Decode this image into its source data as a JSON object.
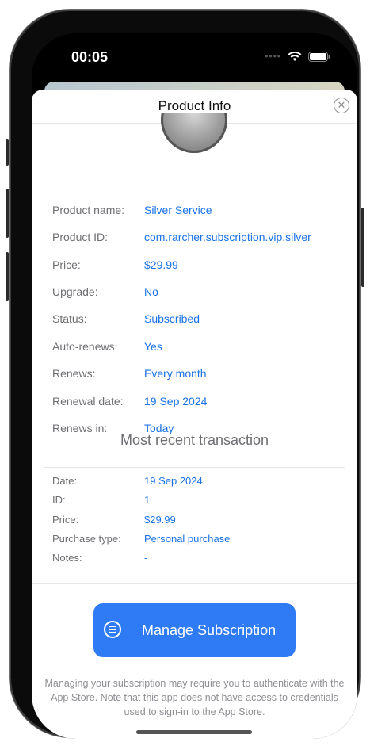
{
  "status_bar": {
    "time": "00:05"
  },
  "sheet": {
    "title": "Product Info",
    "close_icon": "xmark-circle",
    "badge_icon": "silver-laurel-badge"
  },
  "product": {
    "rows": [
      {
        "label": "Product name:",
        "value": "Silver Service"
      },
      {
        "label": "Product ID:",
        "value": "com.rarcher.subscription.vip.silver"
      },
      {
        "label": "Price:",
        "value": "$29.99"
      },
      {
        "label": "Upgrade:",
        "value": "No"
      },
      {
        "label": "Status:",
        "value": "Subscribed"
      },
      {
        "label": "Auto-renews:",
        "value": "Yes"
      },
      {
        "label": "Renews:",
        "value": "Every month"
      },
      {
        "label": "Renewal date:",
        "value": "19 Sep 2024"
      },
      {
        "label": "Renews in:",
        "value": "Today"
      }
    ]
  },
  "transaction": {
    "section_title": "Most recent transaction",
    "rows": [
      {
        "label": "Date:",
        "value": "19 Sep 2024"
      },
      {
        "label": "ID:",
        "value": "1"
      },
      {
        "label": "Price:",
        "value": "$29.99"
      },
      {
        "label": "Purchase type:",
        "value": "Personal purchase"
      },
      {
        "label": "Notes:",
        "value": "-"
      }
    ]
  },
  "manage": {
    "label": "Manage Subscription",
    "icon": "creditcard-circle",
    "footnote": "Managing your subscription may require you to authenticate with the App Store. Note that this app does not have access to credentials used to sign-in to the App Store."
  },
  "colors": {
    "accent": "#1a73e8",
    "button": "#2f7bf6",
    "label_gray": "#6e6e73"
  }
}
